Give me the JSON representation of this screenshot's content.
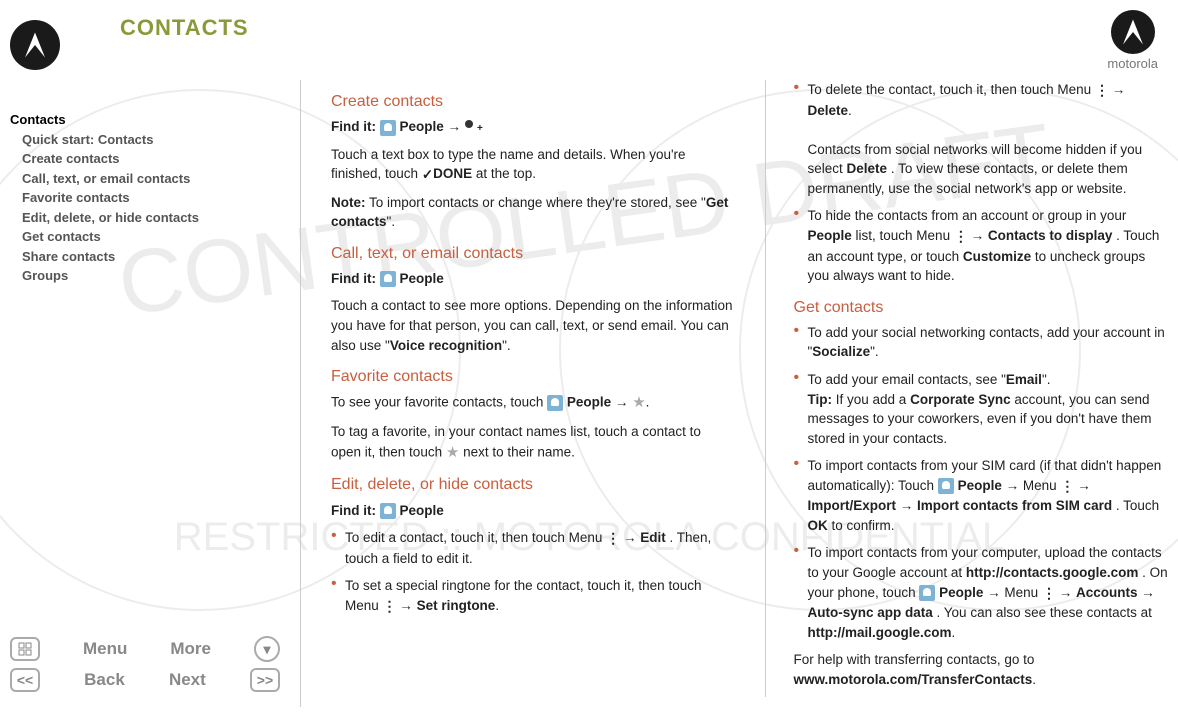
{
  "header": {
    "title": "CONTACTS"
  },
  "brand": {
    "word": "motorola"
  },
  "nav": {
    "root": "Contacts",
    "items": [
      "Quick start: Contacts",
      "Create contacts",
      "Call, text, or email contacts",
      "Favorite contacts",
      "Edit, delete, or hide contacts",
      "Get contacts",
      "Share contacts",
      "Groups"
    ]
  },
  "controls": {
    "menu": "Menu",
    "more": "More",
    "back": "Back",
    "next": "Next"
  },
  "sections": {
    "create": {
      "title": "Create contacts",
      "find_label": "Find it:",
      "find_value": "People",
      "p1a": "Touch a text box to type the name and details. When you're finished, touch ",
      "done": "DONE",
      "p1b": " at the top.",
      "note_label": "Note:",
      "note_text": " To import contacts or change where they're stored, see \"",
      "note_link": "Get contacts",
      "note_text_end": "\"."
    },
    "call": {
      "title": "Call, text, or email contacts",
      "find_label": "Find it:",
      "find_value": "People",
      "p1": "Touch a contact to see more options. Depending on the information you have for that person, you can call, text, or send email. You can also use \"",
      "link": "Voice recognition",
      "p1_end": "\"."
    },
    "fav": {
      "title": "Favorite contacts",
      "p1a": "To see your favorite contacts, touch ",
      "p1b": "People",
      "p2": "To tag a favorite, in your contact names list, touch a contact to open it, then touch ",
      "p2_end": " next to their name."
    },
    "edit": {
      "title": "Edit, delete, or hide contacts",
      "find_label": "Find it:",
      "find_value": "People",
      "b1a": "To edit a contact, touch it, then touch Menu ",
      "b1_edit": "Edit",
      "b1b": ". Then, touch a field to edit it.",
      "b2a": "To set a special ringtone for the contact, touch it, then touch Menu ",
      "b2_set": "Set ringtone",
      "b3a": "To delete the contact, touch it, then touch Menu ",
      "b3_del": "Delete",
      "b3b": "Contacts from social networks will become hidden if you select ",
      "b3c": ". To view these contacts, or delete them permanently, use the social network's app or website.",
      "b4a": "To hide the contacts from an account or group in your ",
      "b4_people": "People",
      "b4b": " list, touch Menu ",
      "b4_ctd": "Contacts to display",
      "b4c": ". Touch an account type, or touch ",
      "b4_cust": "Customize",
      "b4d": " to uncheck groups you always want to hide."
    },
    "get": {
      "title": "Get contacts",
      "b1a": "To add your social networking contacts, add your account in \"",
      "b1_soc": "Socialize",
      "b1b": "\".",
      "b2a": "To add your email contacts, see \"",
      "b2_email": "Email",
      "b2b": "\".",
      "tip_label": "Tip:",
      "tip_text": " If you add a ",
      "tip_corp": "Corporate Sync",
      "tip_text2": " account, you can send messages to your coworkers, even if you don't have them stored in your contacts.",
      "b3a": "To import contacts from your SIM card (if that didn't happen automatically): Touch ",
      "b3_people": "People",
      "b3b": " Menu ",
      "b3_ie": "Import/Export",
      "b3_import": "Import contacts from SIM card",
      "b3c": ". Touch ",
      "b3_ok": "OK",
      "b3d": " to confirm.",
      "b4a": "To import contacts from your computer, upload the contacts to your Google account at ",
      "b4_url1": "http://contacts.google.com",
      "b4b": ". On your phone, touch ",
      "b4_people": "People",
      "b4c": " Menu ",
      "b4_acc": "Accounts",
      "b4_auto": "Auto-sync app data",
      "b4d": ". You can also see these contacts at ",
      "b4_url2": "http://mail.google.com",
      "outro1": "For help with transferring contacts, go to ",
      "outro2": "www.motorola.com/TransferContacts"
    }
  },
  "glyphs": {
    "arrow": "→"
  }
}
